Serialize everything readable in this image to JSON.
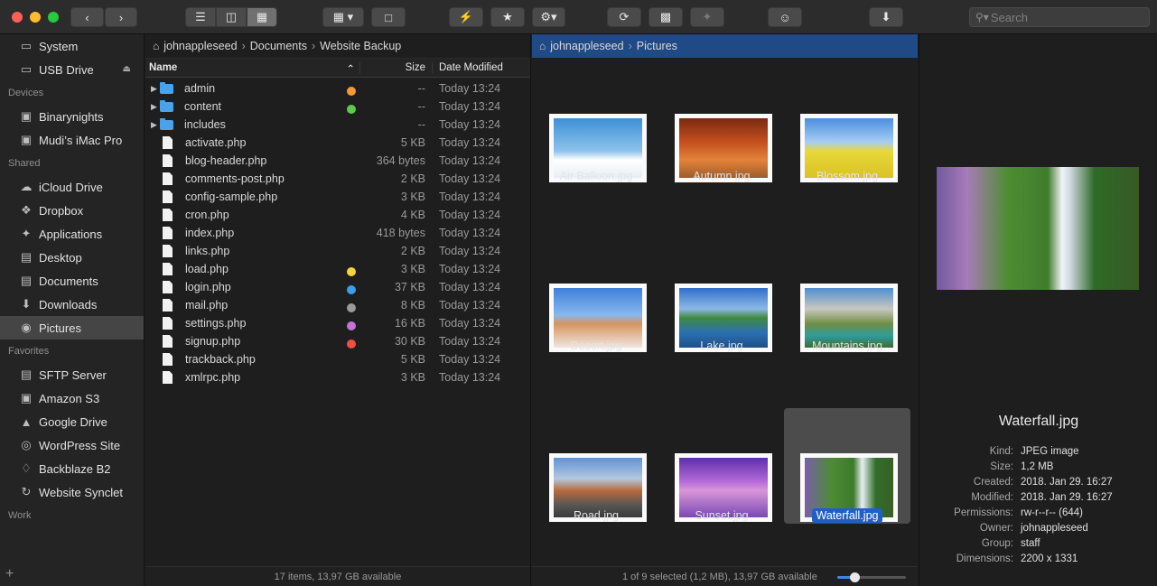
{
  "toolbar": {
    "search_placeholder": "Search"
  },
  "sidebar": {
    "sections": [
      {
        "title": "Devices",
        "items": [
          {
            "label": "System",
            "icon": "hard-drive-icon"
          },
          {
            "label": "USB Drive",
            "icon": "usb-drive-icon",
            "eject": true
          }
        ]
      },
      {
        "title": "Shared",
        "items": [
          {
            "label": "Binarynights",
            "icon": "network-computer-icon"
          },
          {
            "label": "Mudi’s iMac Pro",
            "icon": "imac-icon"
          }
        ]
      },
      {
        "title": "Favorites",
        "items": [
          {
            "label": "iCloud Drive",
            "icon": "cloud-icon"
          },
          {
            "label": "Dropbox",
            "icon": "dropbox-icon"
          },
          {
            "label": "Applications",
            "icon": "applications-icon"
          },
          {
            "label": "Desktop",
            "icon": "desktop-icon"
          },
          {
            "label": "Documents",
            "icon": "documents-icon"
          },
          {
            "label": "Downloads",
            "icon": "downloads-icon"
          },
          {
            "label": "Pictures",
            "icon": "camera-icon",
            "selected": true
          }
        ]
      },
      {
        "title": "Work",
        "items": [
          {
            "label": "SFTP Server",
            "icon": "server-icon"
          },
          {
            "label": "Amazon S3",
            "icon": "s3-icon"
          },
          {
            "label": "Google Drive",
            "icon": "google-drive-icon"
          },
          {
            "label": "WordPress Site",
            "icon": "globe-icon"
          },
          {
            "label": "Backblaze B2",
            "icon": "backblaze-icon"
          },
          {
            "label": "Website Synclet",
            "icon": "sync-icon"
          }
        ]
      }
    ]
  },
  "left_pane": {
    "breadcrumb": [
      "johnappleseed",
      "Documents",
      "Website Backup"
    ],
    "columns": {
      "name": "Name",
      "size": "Size",
      "date": "Date Modified"
    },
    "files": [
      {
        "name": "admin",
        "type": "folder",
        "size": "--",
        "date": "Today 13:24",
        "tag": "#f29a38"
      },
      {
        "name": "content",
        "type": "folder",
        "size": "--",
        "date": "Today 13:24",
        "tag": "#5ccb4a"
      },
      {
        "name": "includes",
        "type": "folder",
        "size": "--",
        "date": "Today 13:24",
        "tag": ""
      },
      {
        "name": "activate.php",
        "type": "file",
        "size": "5 KB",
        "date": "Today 13:24",
        "tag": ""
      },
      {
        "name": "blog-header.php",
        "type": "file",
        "size": "364 bytes",
        "date": "Today 13:24",
        "tag": ""
      },
      {
        "name": "comments-post.php",
        "type": "file",
        "size": "2 KB",
        "date": "Today 13:24",
        "tag": ""
      },
      {
        "name": "config-sample.php",
        "type": "file",
        "size": "3 KB",
        "date": "Today 13:24",
        "tag": ""
      },
      {
        "name": "cron.php",
        "type": "file",
        "size": "4 KB",
        "date": "Today 13:24",
        "tag": ""
      },
      {
        "name": "index.php",
        "type": "file",
        "size": "418 bytes",
        "date": "Today 13:24",
        "tag": ""
      },
      {
        "name": "links.php",
        "type": "file",
        "size": "2 KB",
        "date": "Today 13:24",
        "tag": ""
      },
      {
        "name": "load.php",
        "type": "file",
        "size": "3 KB",
        "date": "Today 13:24",
        "tag": "#f5d33c"
      },
      {
        "name": "login.php",
        "type": "file",
        "size": "37 KB",
        "date": "Today 13:24",
        "tag": "#3a9df0"
      },
      {
        "name": "mail.php",
        "type": "file",
        "size": "8 KB",
        "date": "Today 13:24",
        "tag": "#9a9a9a"
      },
      {
        "name": "settings.php",
        "type": "file",
        "size": "16 KB",
        "date": "Today 13:24",
        "tag": "#c573d9"
      },
      {
        "name": "signup.php",
        "type": "file",
        "size": "30 KB",
        "date": "Today 13:24",
        "tag": "#f04f45"
      },
      {
        "name": "trackback.php",
        "type": "file",
        "size": "5 KB",
        "date": "Today 13:24",
        "tag": ""
      },
      {
        "name": "xmlrpc.php",
        "type": "file",
        "size": "3 KB",
        "date": "Today 13:24",
        "tag": ""
      }
    ],
    "status": "17 items, 13,97 GB available"
  },
  "right_pane": {
    "breadcrumb": [
      "johnappleseed",
      "Pictures"
    ],
    "images": [
      {
        "name": "Air Balloon.jpg",
        "gradient": "linear-gradient(180deg,#3d8fd6 0%,#8ec3ec 55%,#ffffff 70%,#e8eef4 100%)"
      },
      {
        "name": "Autumn.jpg",
        "gradient": "linear-gradient(180deg,#7a2a10 0%,#c4501e 40%,#e3833a 70%,#9c5c2c 100%)"
      },
      {
        "name": "Blossom.jpg",
        "gradient": "linear-gradient(180deg,#4a8fe0 0%,#a7cdf3 40%,#e8d83a 55%,#d9c227 100%)"
      },
      {
        "name": "Desert.jpg",
        "gradient": "linear-gradient(180deg,#3f7fd9 0%,#86b8ee 45%,#d6955f 60%,#f0e6e0 100%)"
      },
      {
        "name": "Lake.jpg",
        "gradient": "linear-gradient(180deg,#2f6fcb 0%,#8db9e6 35%,#3f8a3f 50%,#2b6fb4 75%,#1f4f87 100%)"
      },
      {
        "name": "Mountains.jpg",
        "gradient": "linear-gradient(180deg,#4f8fd0 0%,#c9c7c0 35%,#6f8e43 60%,#2e9d9c 80%,#3e6b30 100%)"
      },
      {
        "name": "Road.jpg",
        "gradient": "linear-gradient(180deg,#5f93d6 0%,#b3c8df 35%,#b86a3c 55%,#555 80%,#3a3a3a 100%)"
      },
      {
        "name": "Sunset.jpg",
        "gradient": "linear-gradient(180deg,#5e2fa8 0%,#b46ad9 40%,#d996d9 55%,#7a48b3 100%)"
      },
      {
        "name": "Waterfall.jpg",
        "gradient": "linear-gradient(90deg,#7a5fa8 0%,#4d8c34 30%,#3d7a2a 55%,#e9eef3 65%,#2f6f2a 80%,#3a5f25 100%)",
        "selected": true
      }
    ],
    "status": "1 of 9 selected (1,2 MB), 13,97 GB available",
    "zoom": 0.25
  },
  "preview": {
    "title": "Waterfall.jpg",
    "gradient": "linear-gradient(90deg,#6f5a9e 0%,#a87bb8 15%,#4f8d33 35%,#3f7d2c 55%,#f0f4f8 62%,#cfd8e0 66%,#2f6a27 78%,#365a25 100%)",
    "meta": [
      {
        "k": "Kind:",
        "v": "JPEG image"
      },
      {
        "k": "Size:",
        "v": "1,2 MB"
      },
      {
        "k": "Created:",
        "v": "2018. Jan 29. 16:27"
      },
      {
        "k": "Modified:",
        "v": "2018. Jan 29. 16:27"
      },
      {
        "k": "Permissions:",
        "v": "rw-r--r-- (644)"
      },
      {
        "k": "Owner:",
        "v": "johnappleseed"
      },
      {
        "k": "Group:",
        "v": "staff"
      },
      {
        "k": "Dimensions:",
        "v": "2200 x 1331"
      }
    ]
  }
}
